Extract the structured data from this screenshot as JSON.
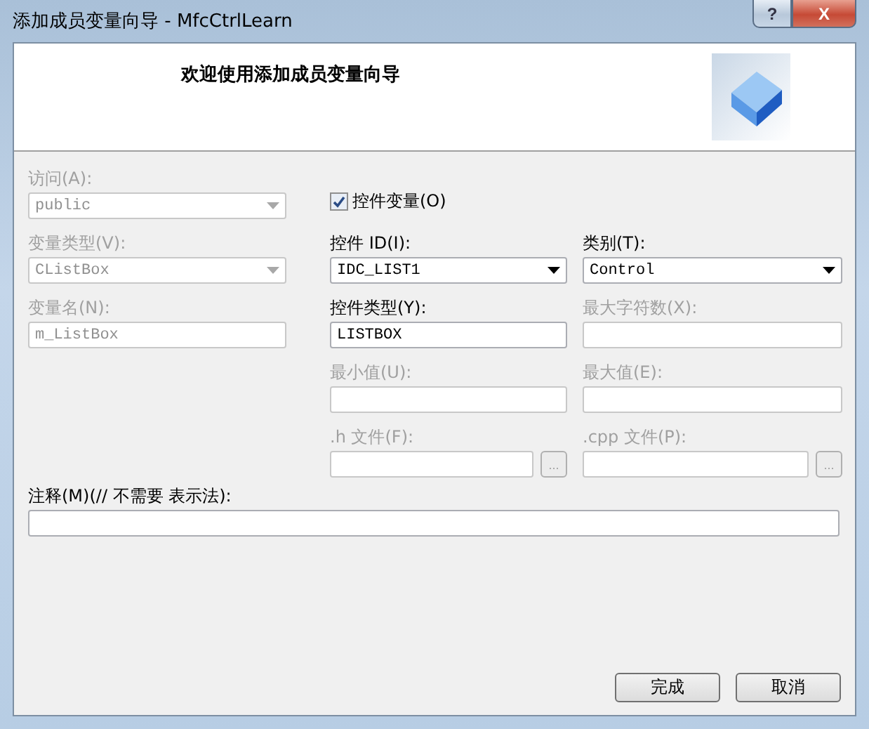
{
  "window": {
    "title": "添加成员变量向导 - MfcCtrlLearn",
    "help_button": "?",
    "close_button": "X"
  },
  "header": {
    "title": "欢迎使用添加成员变量向导"
  },
  "form": {
    "columns": [
      [
        {
          "kind": "combo",
          "label": "访问(A):",
          "value": "public",
          "disabled": true
        },
        {
          "kind": "combo",
          "label": "变量类型(V):",
          "value": "CListBox",
          "disabled": true
        },
        {
          "kind": "edit",
          "label": "变量名(N):",
          "value": "m_ListBox",
          "disabled": true
        }
      ],
      [
        {
          "kind": "checkbox",
          "label": "控件变量(O)",
          "checked": true
        },
        {
          "kind": "combo",
          "label": "控件 ID(I):",
          "value": "IDC_LIST1",
          "disabled": false
        },
        {
          "kind": "edit",
          "label": "控件类型(Y):",
          "value": "LISTBOX",
          "disabled": false
        },
        {
          "kind": "edit",
          "label": "最小值(U):",
          "disabled": true
        },
        {
          "kind": "browse",
          "label": ".h 文件(F):",
          "button": "...",
          "disabled": true
        }
      ],
      [
        {
          "kind": "combo",
          "label": "类别(T):",
          "value": "Control",
          "disabled": false
        },
        {
          "kind": "edit",
          "label": "最大字符数(X):",
          "disabled": true
        },
        {
          "kind": "edit",
          "label": "最大值(E):",
          "disabled": true
        },
        {
          "kind": "browse",
          "label": ".cpp 文件(P):",
          "button": "...",
          "disabled": true
        }
      ]
    ],
    "comment": {
      "label": "注释(M)(// 不需要 表示法):",
      "disabled": false
    }
  },
  "buttons": [
    "完成",
    "取消"
  ]
}
